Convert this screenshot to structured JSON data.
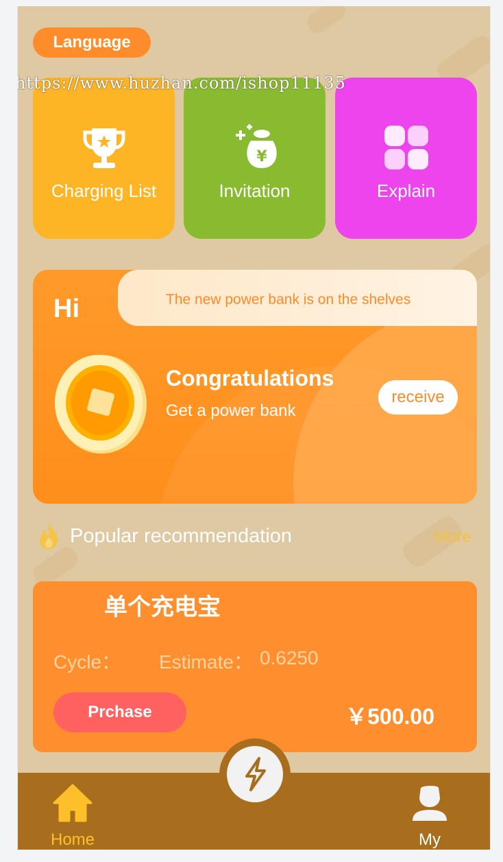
{
  "header": {
    "language_label": "Language"
  },
  "watermark": "https://www.huzhan.com/ishop11135",
  "quick_tiles": [
    {
      "label": "Charging List",
      "icon": "trophy-icon",
      "color": "#fdb425"
    },
    {
      "label": "Invitation",
      "icon": "money-bag-icon",
      "color": "#88bb30"
    },
    {
      "label": "Explain",
      "icon": "grid-icon",
      "color": "#ee44ee"
    }
  ],
  "promo": {
    "greeting": "Hi",
    "notice": "The new power bank is on the shelves",
    "title": "Congratulations",
    "subtitle": "Get a power bank",
    "receive_label": "receive"
  },
  "section": {
    "title": "Popular recommendation",
    "more_label": "More"
  },
  "product": {
    "name": "单个充电宝",
    "cycle_label": "Cycle：",
    "estimate_label": "Estimate：",
    "estimate_value": "0.6250",
    "purchase_label": "Prchase",
    "price": "￥500.00"
  },
  "tabbar": {
    "home_label": "Home",
    "my_label": "My",
    "active": "Home",
    "accent": "#fec02a",
    "bar_color": "#a86e1d"
  }
}
